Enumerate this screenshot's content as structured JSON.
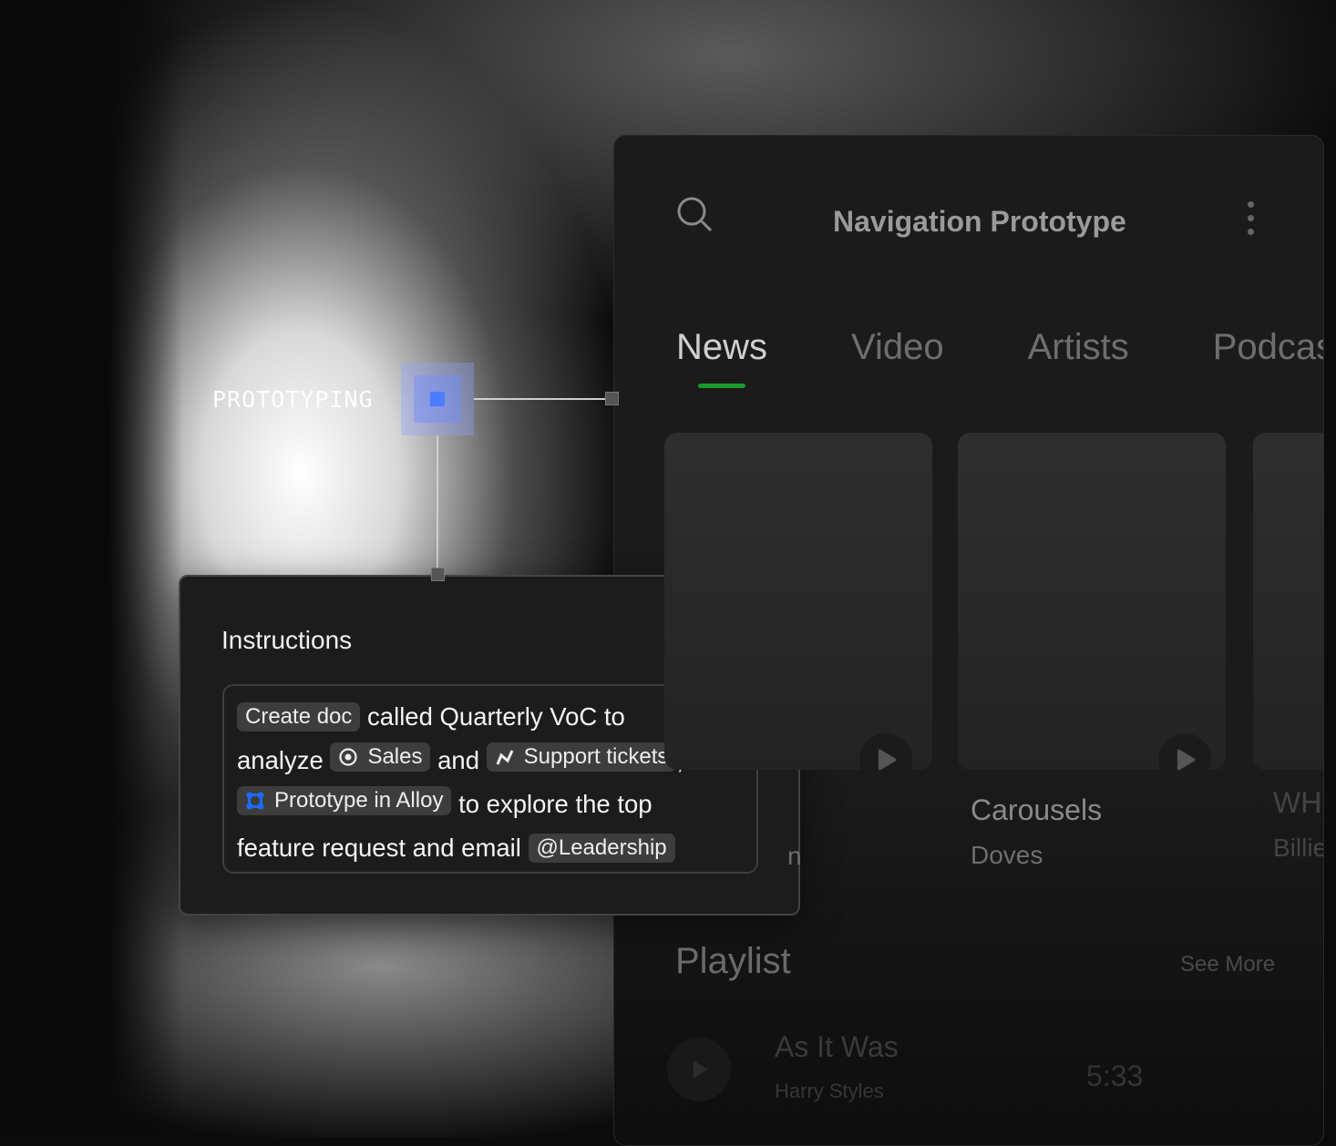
{
  "app": {
    "title": "Navigation Prototype",
    "tabs": [
      {
        "label": "News",
        "active": true
      },
      {
        "label": "Video"
      },
      {
        "label": "Artists"
      },
      {
        "label": "Podcasts"
      }
    ],
    "cards": [
      {
        "title": "",
        "subtitle": "n"
      },
      {
        "title": "Carousels",
        "subtitle": "Doves"
      },
      {
        "title": "WH",
        "subtitle": "Billie"
      }
    ],
    "playlist": {
      "title": "Playlist",
      "see_more": "See More",
      "songs": [
        {
          "title": "As It Was",
          "artist": "Harry Styles",
          "duration": "5:33"
        }
      ]
    },
    "accent": "#1a9a2a"
  },
  "annotation": {
    "label": "PROTOTYPING",
    "node_color": "#4d7cff"
  },
  "instructions": {
    "title": "Instructions",
    "chip_create": "Create doc",
    "t1": "called Quarterly VoC to",
    "t2": "analyze",
    "chip_sales": "Sales",
    "t3": "and",
    "chip_support": "Support tickets",
    "t4": ",",
    "chip_alloy": "Prototype in Alloy",
    "t5": "to explore the top",
    "t6": "feature request and email",
    "chip_leadership": "@Leadership"
  }
}
